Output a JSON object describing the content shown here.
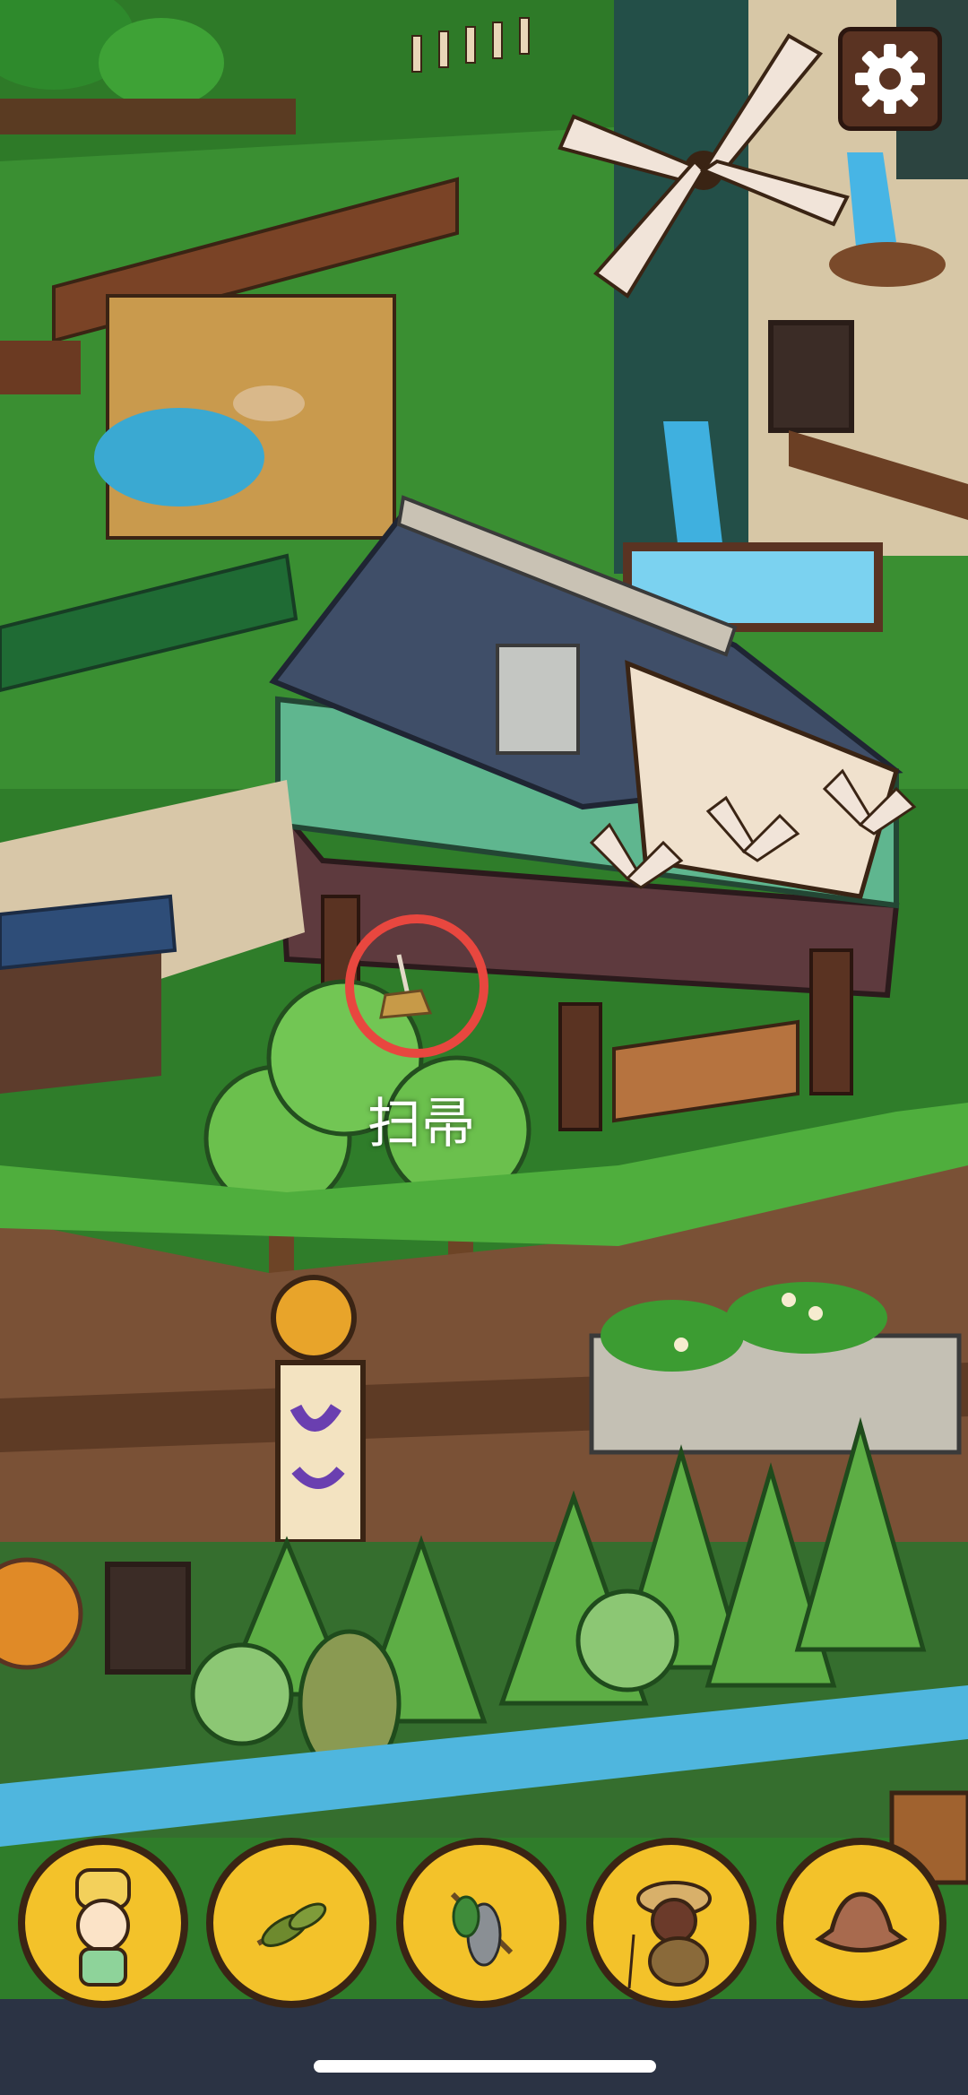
{
  "hud": {
    "settings": {
      "icon": "gear-icon"
    }
  },
  "target": {
    "label": "扫帚",
    "marker_color": "#e8473f"
  },
  "hotbar": {
    "slots": [
      {
        "icon": "chef-character-icon"
      },
      {
        "icon": "herbs-bundle-icon"
      },
      {
        "icon": "fish-on-stick-icon"
      },
      {
        "icon": "fisherman-character-icon"
      },
      {
        "icon": "brown-hat-icon"
      }
    ],
    "slot_color": "#f3c22a",
    "border_color": "#3a2414"
  }
}
